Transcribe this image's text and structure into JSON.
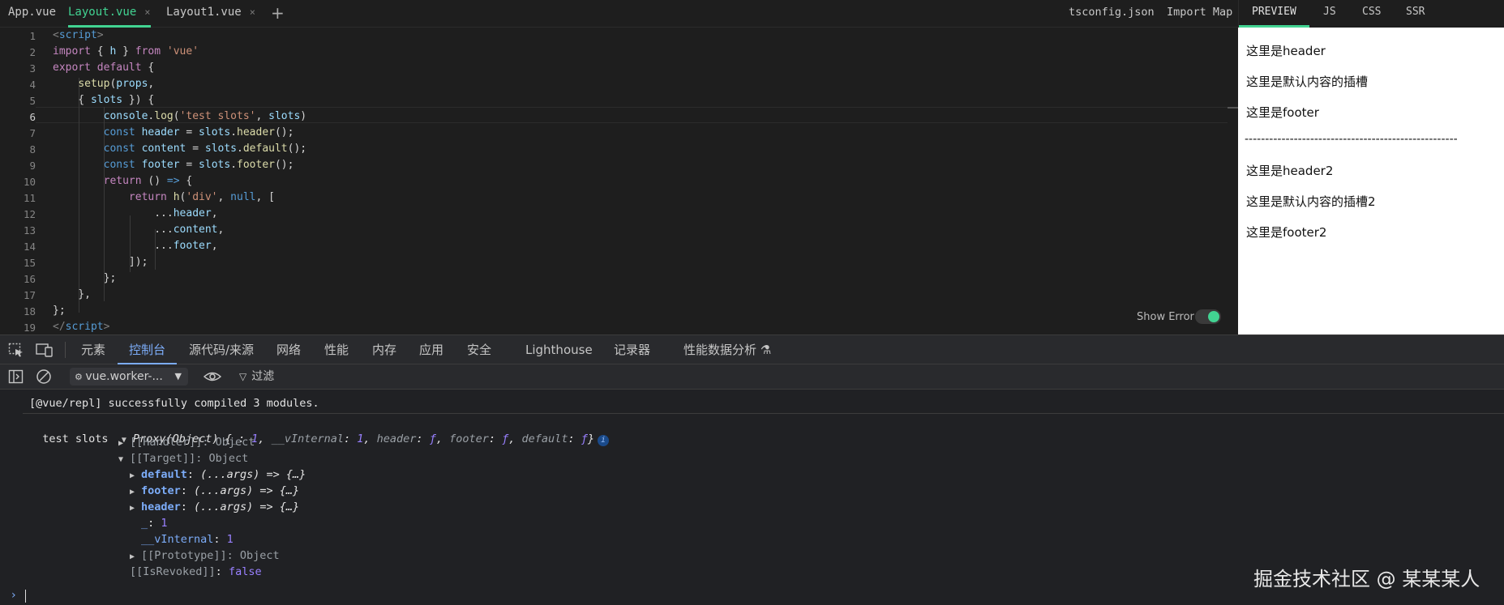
{
  "file_tabs": [
    {
      "label": "App.vue"
    },
    {
      "label": "Layout.vue",
      "close": "×"
    },
    {
      "label": "Layout1.vue",
      "close": "×"
    }
  ],
  "add_tab": "+",
  "right_links": {
    "tsconfig": "tsconfig.json",
    "import_map": "Import Map"
  },
  "preview_tabs": [
    "PREVIEW",
    "JS",
    "CSS",
    "SSR"
  ],
  "editor": {
    "line_numbers": [
      "1",
      "2",
      "3",
      "4",
      "5",
      "6",
      "7",
      "8",
      "9",
      "10",
      "11",
      "12",
      "13",
      "14",
      "15",
      "16",
      "17",
      "18",
      "19"
    ],
    "current_line": "6"
  },
  "show_error": {
    "label": "Show Error",
    "enabled": true
  },
  "preview_lines": [
    "这里是header",
    "这里是默认内容的插槽",
    "这里是footer",
    "----------------------------------------------------",
    "这里是header2",
    "这里是默认内容的插槽2",
    "这里是footer2"
  ],
  "devtools": {
    "tabs": [
      "元素",
      "控制台",
      "源代码/来源",
      "网络",
      "性能",
      "内存",
      "应用",
      "安全",
      "Lighthouse",
      "记录器",
      "性能数据分析 ⚗"
    ],
    "active_tab": "控制台",
    "context": "vue.worker-...",
    "filter_placeholder": "过滤"
  },
  "console": {
    "compiled_msg": "[@vue/repl] successfully compiled 3 modules.",
    "log_label": "test slots",
    "proxy_summary_head": "Proxy(Object)",
    "handler": "[[Handler]]: Object",
    "target": "[[Target]]: Object",
    "default_key": "default",
    "footer_key": "footer",
    "header_key": "header",
    "fn_value": "(...args) => {…}",
    "underscore_key": "_",
    "underscore_val": "1",
    "vinternal_key": "__vInternal",
    "vinternal_val": "1",
    "prototype": "[[Prototype]]: Object",
    "isrevoked_key": "[[IsRevoked]]",
    "isrevoked_val": "false",
    "info_badge": "i",
    "prompt": "›"
  },
  "watermark": "掘金技术社区 @ 某某某人",
  "colors": {
    "accent_green": "#42d392",
    "devtools_blue": "#7cacf8"
  }
}
